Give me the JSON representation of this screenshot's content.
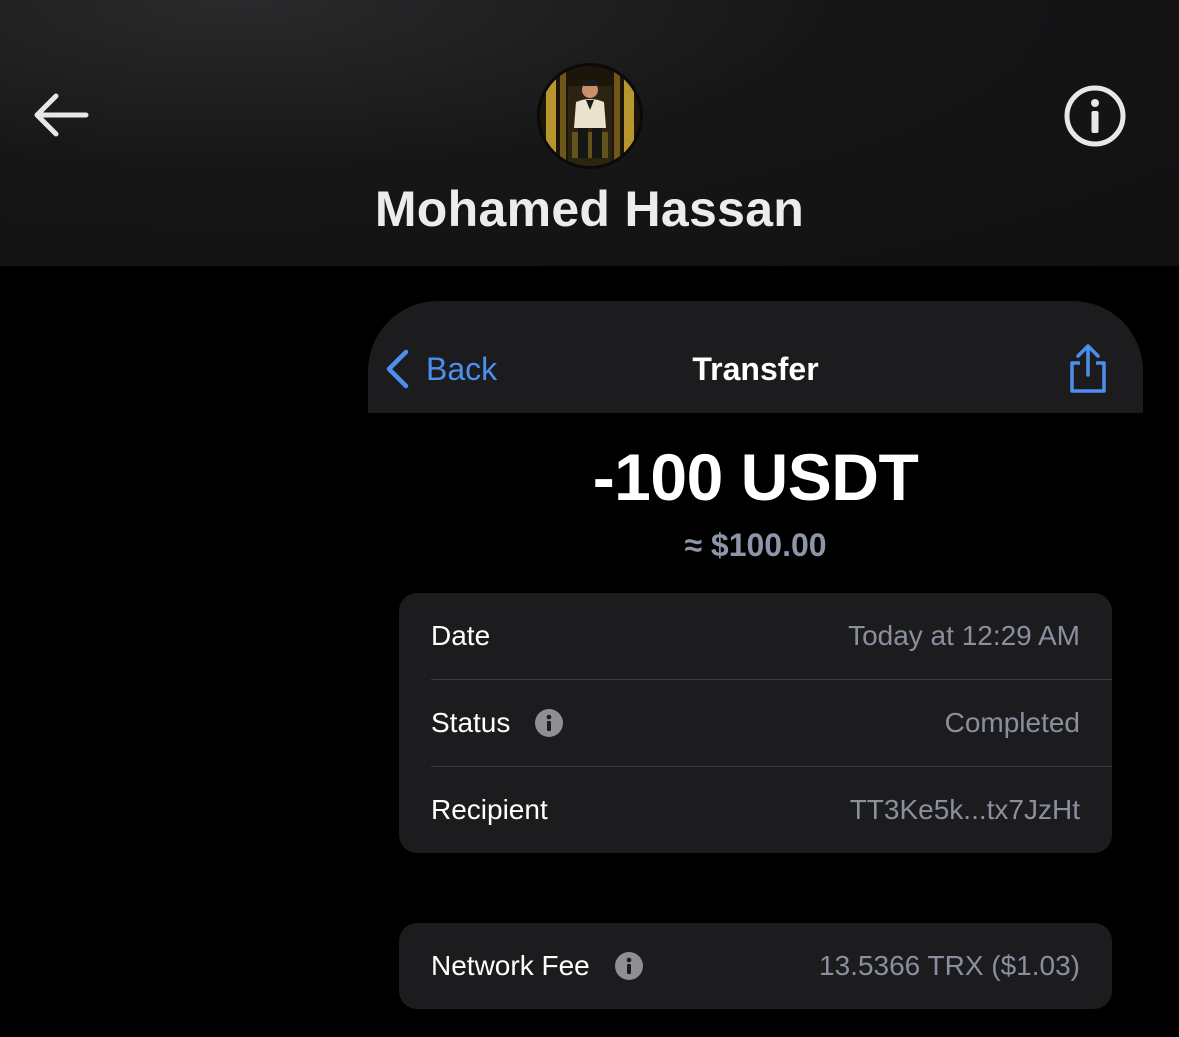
{
  "header": {
    "contact_name": "Mohamed Hassan",
    "back_icon": "arrow-left-icon",
    "info_icon": "info-circle-icon"
  },
  "transfer": {
    "nav": {
      "back_label": "Back",
      "title": "Transfer",
      "share_icon": "share-icon"
    },
    "amount": "-100 USDT",
    "fiat_amount": "≈ $100.00",
    "details": [
      {
        "label": "Date",
        "value": "Today at 12:29 AM"
      },
      {
        "label": "Status",
        "value": "Completed"
      },
      {
        "label": "Recipient",
        "value": "TT3Ke5k...tx7JzHt"
      }
    ],
    "network_fee": {
      "label": "Network Fee",
      "value": "13.5366 TRX ($1.03)"
    }
  },
  "colors": {
    "accent_blue": "#4d8ff0",
    "secondary_text": "#8a8f9e",
    "group_background": "#1c1c1e",
    "page_background": "#000000"
  }
}
